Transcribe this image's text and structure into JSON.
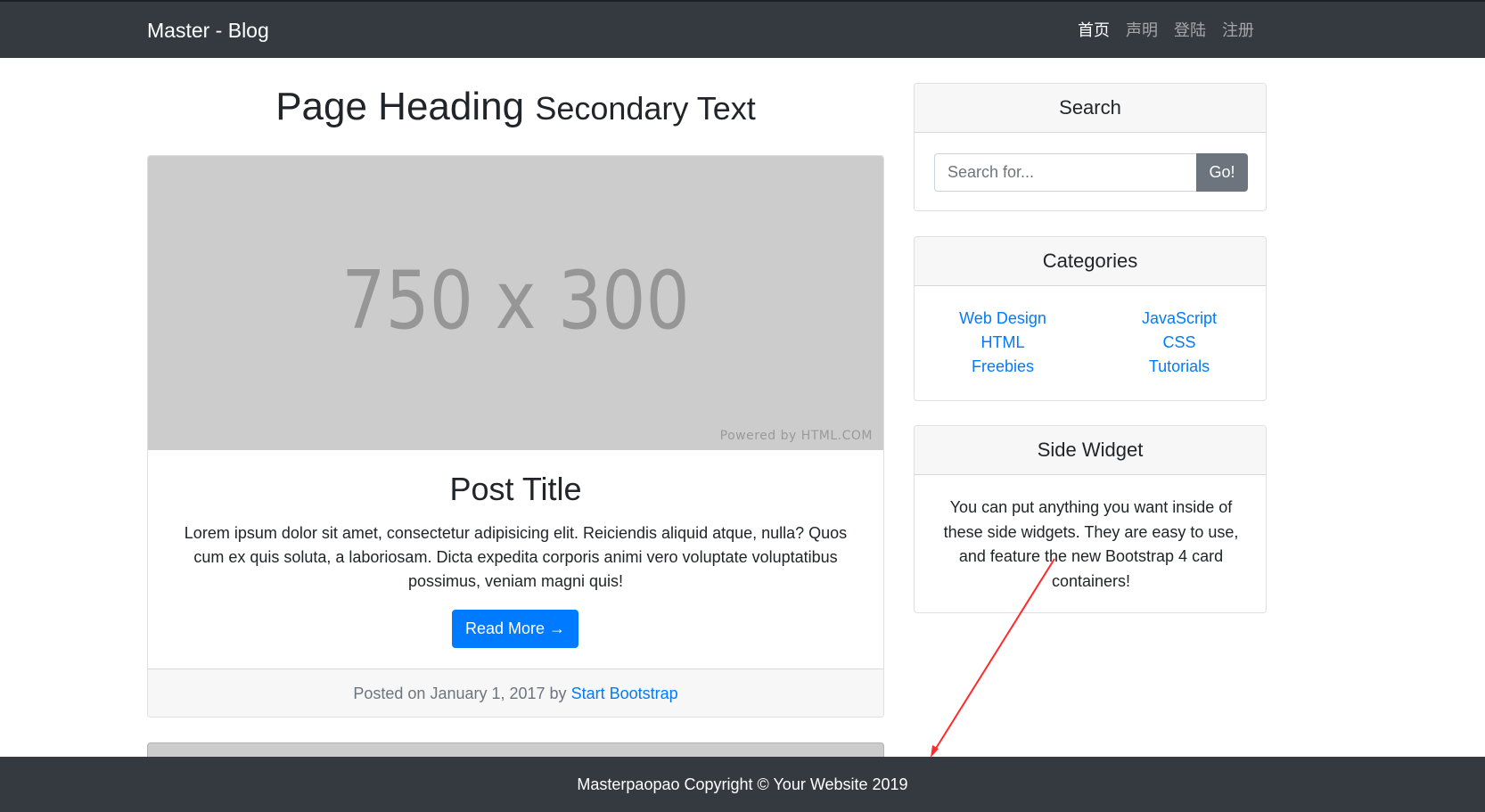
{
  "navbar": {
    "brand": "Master - Blog",
    "links": [
      {
        "label": "首页",
        "active": true
      },
      {
        "label": "声明",
        "active": false
      },
      {
        "label": "登陆",
        "active": false
      },
      {
        "label": "注册",
        "active": false
      }
    ]
  },
  "main": {
    "heading": "Page Heading",
    "heading_secondary": "Secondary Text",
    "post": {
      "image_text": "750 x 300",
      "image_credit": "Powered by HTML.COM",
      "title": "Post Title",
      "body": "Lorem ipsum dolor sit amet, consectetur adipisicing elit. Reiciendis aliquid atque, nulla? Quos cum ex quis soluta, a laboriosam. Dicta expedita corporis animi vero voluptate voluptatibus possimus, veniam magni quis!",
      "read_more_label": "Read More →",
      "footer_prefix": "Posted on January 1, 2017 by",
      "author": "Start Bootstrap"
    }
  },
  "sidebar": {
    "search": {
      "title": "Search",
      "placeholder": "Search for...",
      "button_label": "Go!"
    },
    "categories": {
      "title": "Categories",
      "left": [
        "Web Design",
        "HTML",
        "Freebies"
      ],
      "right": [
        "JavaScript",
        "CSS",
        "Tutorials"
      ]
    },
    "side_widget": {
      "title": "Side Widget",
      "text": "You can put anything you want inside of these side widgets. They are easy to use, and feature the new Bootstrap 4 card containers!"
    }
  },
  "footer": {
    "text": "Masterpaopao Copyright © Your Website 2019"
  },
  "colors": {
    "navbar_bg": "#343a40",
    "link": "#007bff",
    "button_secondary": "#6c757d",
    "annotation": "#ff2a2a"
  }
}
